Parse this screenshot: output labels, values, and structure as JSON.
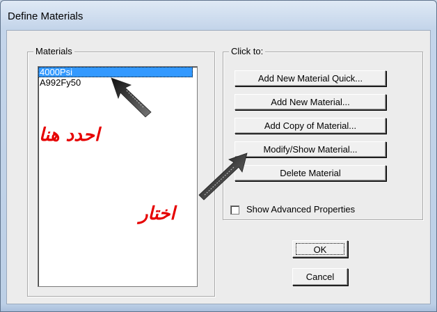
{
  "window": {
    "title": "Define Materials"
  },
  "materials": {
    "legend": "Materials",
    "items": [
      "4000Psi",
      "A992Fy50"
    ],
    "selected_index": 0
  },
  "click_to": {
    "legend": "Click to:",
    "buttons": {
      "add_quick": "Add New Material Quick...",
      "add_new": "Add New Material...",
      "add_copy": "Add Copy of Material...",
      "modify_show": "Modify/Show Material...",
      "delete": "Delete Material"
    },
    "show_advanced": {
      "label": "Show Advanced Properties",
      "checked": false
    }
  },
  "footer": {
    "ok": "OK",
    "cancel": "Cancel"
  },
  "annotations": {
    "select_here": "احدد هنا",
    "choose": "اختار"
  },
  "colors": {
    "annotation": "#e60000",
    "selection": "#3399ff"
  }
}
